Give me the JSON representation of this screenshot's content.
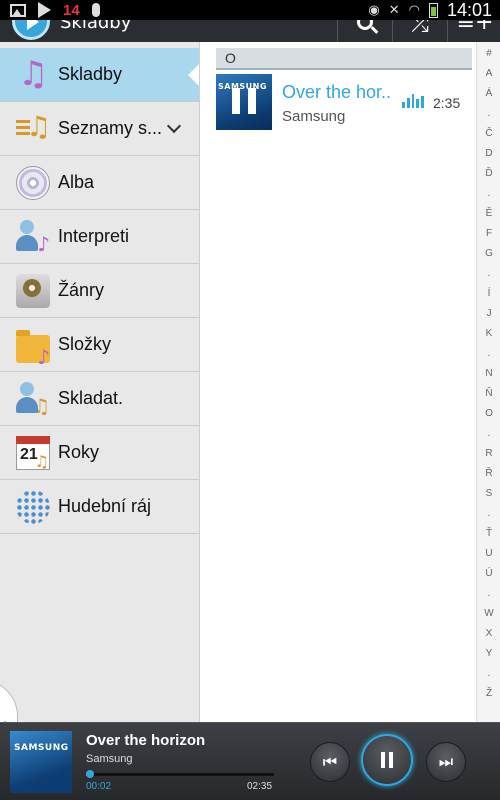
{
  "status_bar": {
    "notification_count": "14",
    "clock": "14:01"
  },
  "action_bar": {
    "title": "Skladby",
    "search_icon": "search-icon",
    "shuffle_icon": "shuffle-icon",
    "add_icon": "add-to-playlist-icon"
  },
  "sidebar": {
    "items": [
      {
        "label": "Skladby",
        "icon": "music-note-icon",
        "active": true
      },
      {
        "label": "Seznamy s...",
        "icon": "playlist-icon",
        "expandable": true
      },
      {
        "label": "Alba",
        "icon": "album-disc-icon"
      },
      {
        "label": "Interpreti",
        "icon": "artist-icon"
      },
      {
        "label": "Žánry",
        "icon": "genre-icon"
      },
      {
        "label": "Složky",
        "icon": "folder-icon"
      },
      {
        "label": "Skladat.",
        "icon": "composer-icon"
      },
      {
        "label": "Roky",
        "icon": "calendar-icon",
        "calendar_day": "21"
      },
      {
        "label": "Hudební ráj",
        "icon": "music-hub-icon"
      }
    ]
  },
  "song_list": {
    "section": "O",
    "songs": [
      {
        "title": "Over the hor..",
        "artist": "Samsung",
        "duration": "2:35",
        "playing": true,
        "art_text": "SAMSUNG"
      }
    ]
  },
  "index_letters": [
    "#",
    "A",
    "Á",
    ".",
    "Č",
    "D",
    "Ď",
    ".",
    "Ě",
    "F",
    "G",
    ".",
    "Í",
    "J",
    "K",
    ".",
    "N",
    "Ň",
    "O",
    ".",
    "R",
    "Ř",
    "S",
    ".",
    "Ť",
    "U",
    "Ú",
    ".",
    "W",
    "X",
    "Y",
    ".",
    "Ž"
  ],
  "player": {
    "title": "Over the horizon",
    "artist": "Samsung",
    "art_text": "SAMSUNG",
    "elapsed": "00:02",
    "total": "02:35",
    "progress": 0.013
  },
  "colors": {
    "accent": "#2fa8e0",
    "sidebar_active": "#a9d8ee",
    "player_bg": "#2b2e32"
  }
}
